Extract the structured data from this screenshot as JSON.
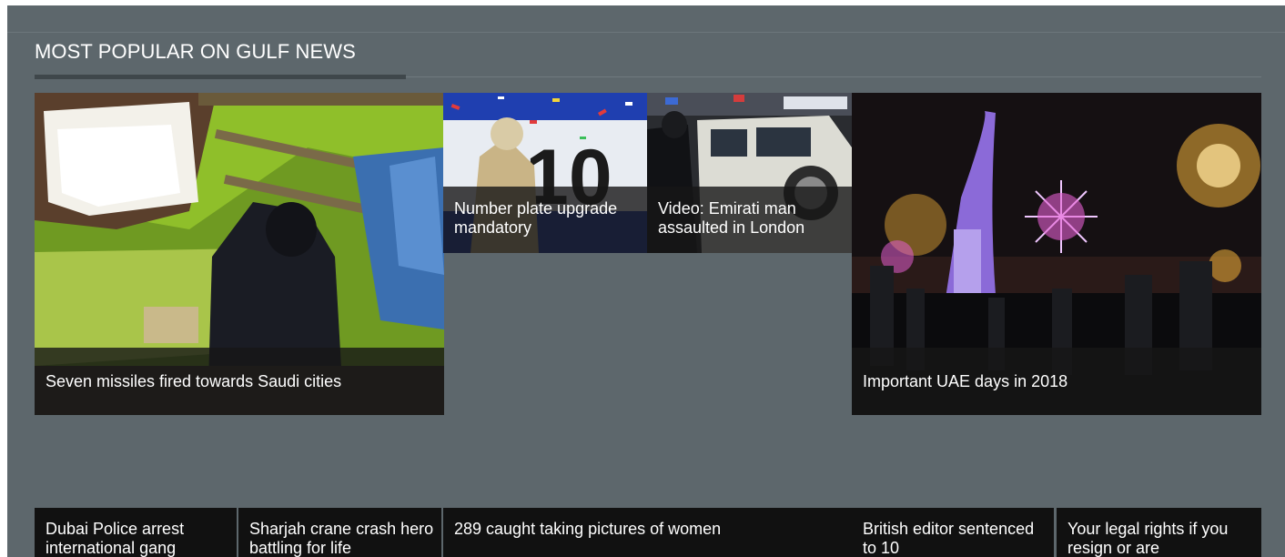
{
  "section": {
    "title": "MOST POPULAR ON GULF NEWS"
  },
  "tiles": [
    {
      "caption": "Seven missiles fired towards Saudi cities"
    },
    {
      "caption": "Number plate upgrade mandatory"
    },
    {
      "caption": "Video: Emirati man assaulted in London"
    },
    {
      "caption": "Important UAE days in 2018"
    }
  ],
  "headlines": [
    "Dubai Police arrest international gang",
    "Sharjah crane crash hero battling for life",
    "289 caught taking pictures of women",
    "British editor sentenced to 10",
    "Your legal rights if you resign or are"
  ],
  "colors": {
    "panel": "#5d676c",
    "caption_bg": "#161616",
    "text": "#ffffff"
  }
}
